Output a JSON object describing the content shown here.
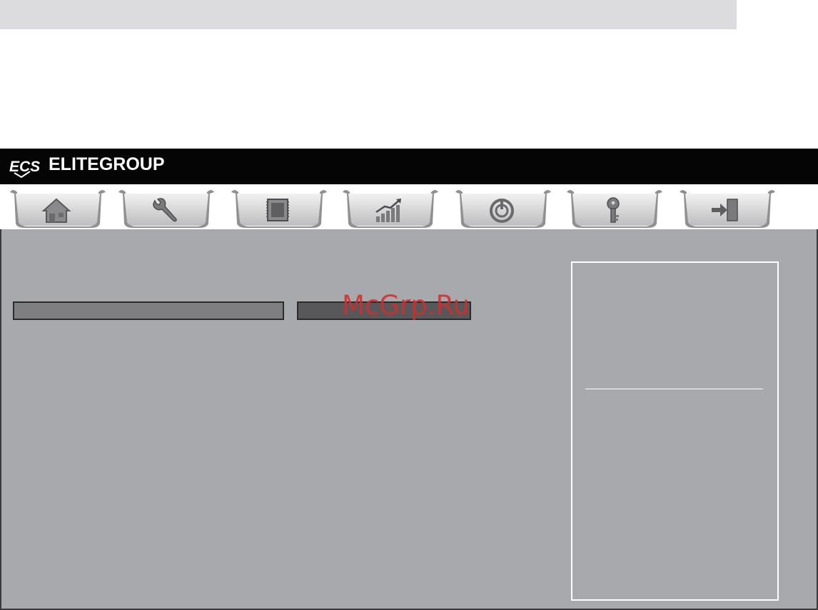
{
  "header": {
    "logo_mark": "ECS",
    "brand": "ELITEGROUP"
  },
  "tabs": [
    {
      "icon": "home-icon"
    },
    {
      "icon": "wrench-icon"
    },
    {
      "icon": "cpu-chip-icon"
    },
    {
      "icon": "performance-chart-icon"
    },
    {
      "icon": "power-icon"
    },
    {
      "icon": "key-icon"
    },
    {
      "icon": "exit-door-icon"
    }
  ],
  "watermark": "McGrp.Ru",
  "colors": {
    "header_bg": "#050505",
    "panel_bg": "#a8a9ad",
    "watermark": "#d62b2b"
  }
}
